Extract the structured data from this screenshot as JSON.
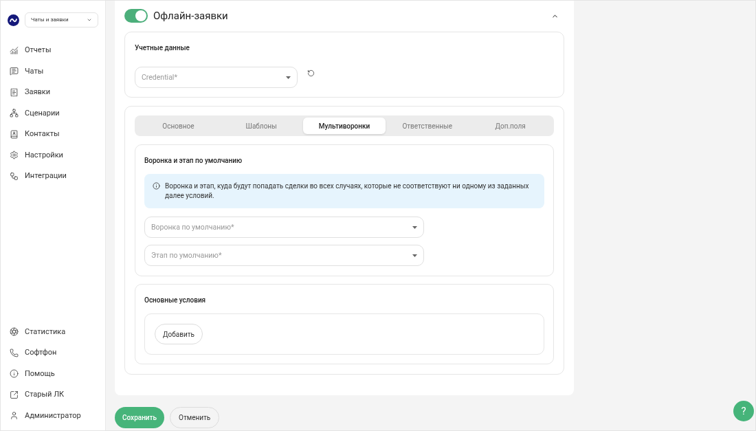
{
  "sidebar": {
    "workspace": "Чаты и заявки",
    "items": [
      {
        "label": "Отчеты"
      },
      {
        "label": "Чаты"
      },
      {
        "label": "Заявки"
      },
      {
        "label": "Сценарии"
      },
      {
        "label": "Контакты"
      },
      {
        "label": "Настройки"
      },
      {
        "label": "Интеграции"
      }
    ],
    "bottom_items": [
      {
        "label": "Статистика"
      },
      {
        "label": "Софтфон"
      },
      {
        "label": "Помощь"
      },
      {
        "label": "Старый ЛК"
      },
      {
        "label": "Администратор"
      }
    ]
  },
  "panel": {
    "title": "Офлайн-заявки",
    "enabled": true,
    "expanded": true,
    "credentials": {
      "title": "Учетные данные",
      "select": {
        "placeholder": "Credential*"
      }
    },
    "tabs": [
      {
        "label": "Основное",
        "selected": false
      },
      {
        "label": "Шаблоны",
        "selected": false
      },
      {
        "label": "Мультиворонки",
        "selected": true
      },
      {
        "label": "Ответственные",
        "selected": false
      },
      {
        "label": "Доп.поля",
        "selected": false
      }
    ],
    "default_section": {
      "title": "Воронка и этап по умолчанию",
      "info": "Воронка и этап, куда будут попадать сделки во всех случаях, которые не соответствуют ни одному из заданных далее условий.",
      "selects": [
        {
          "placeholder": "Воронка по умолчанию*"
        },
        {
          "placeholder": "Этап по умолчанию*"
        }
      ]
    },
    "conditions": {
      "title": "Основные условия",
      "add_button": "Добавить"
    }
  },
  "buttons": {
    "save": "Сохранить",
    "cancel": "Отменить"
  },
  "help_button": "?"
}
